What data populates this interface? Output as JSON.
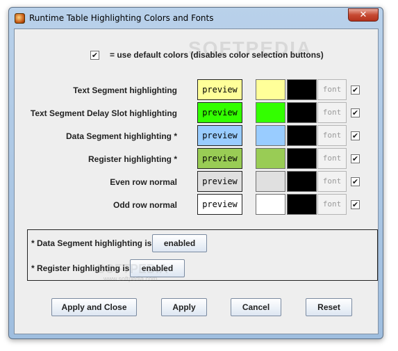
{
  "window": {
    "title": "Runtime Table Highlighting Colors and Fonts",
    "close_glyph": "✕"
  },
  "default_colors": {
    "checked": true,
    "check_glyph": "✔",
    "label": "= use default colors (disables color selection buttons)"
  },
  "rows": [
    {
      "label": "Text Segment highlighting",
      "preview_text": "preview",
      "bg_color": "#ffff99",
      "fg_color": "#000000",
      "font_label": "font",
      "checked": true
    },
    {
      "label": "Text Segment Delay Slot highlighting",
      "preview_text": "preview",
      "bg_color": "#33ff00",
      "fg_color": "#000000",
      "font_label": "font",
      "checked": true
    },
    {
      "label": "Data Segment highlighting *",
      "preview_text": "preview",
      "bg_color": "#99ccff",
      "fg_color": "#000000",
      "font_label": "font",
      "checked": true
    },
    {
      "label": "Register highlighting *",
      "preview_text": "preview",
      "bg_color": "#99cc55",
      "fg_color": "#000000",
      "font_label": "font",
      "checked": true
    },
    {
      "label": "Even row normal",
      "preview_text": "preview",
      "bg_color": "#e0e0e0",
      "fg_color": "#000000",
      "font_label": "font",
      "checked": true
    },
    {
      "label": "Odd row normal",
      "preview_text": "preview",
      "bg_color": "#ffffff",
      "fg_color": "#000000",
      "font_label": "font",
      "checked": true
    }
  ],
  "notes": {
    "data_segment_label": "* Data Segment highlighting is",
    "data_segment_button": "enabled",
    "register_label": "* Register highlighting is",
    "register_button": "enabled"
  },
  "buttons": {
    "apply_close": "Apply and Close",
    "apply": "Apply",
    "cancel": "Cancel",
    "reset": "Reset"
  },
  "watermark": {
    "text": "SOFTPEDIA",
    "url": "www.softpedia.com"
  }
}
